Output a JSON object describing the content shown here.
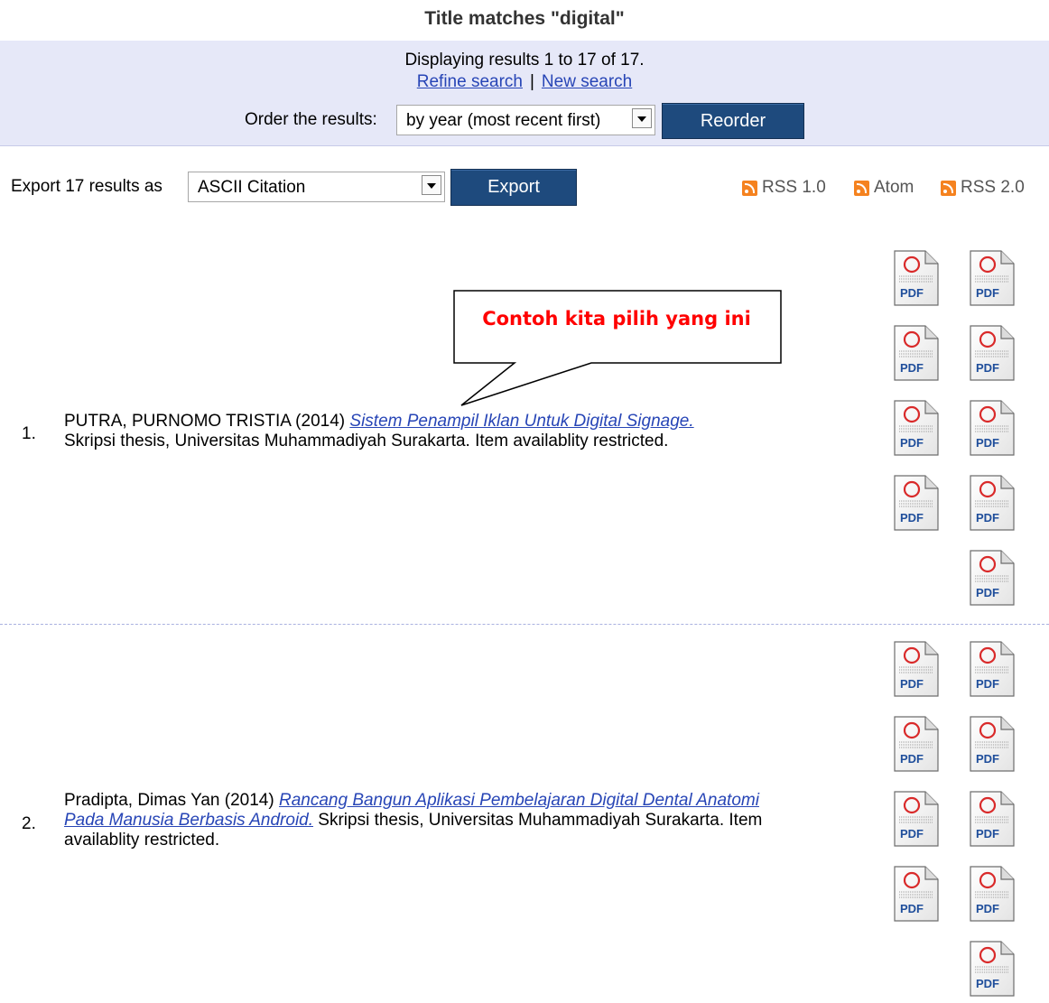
{
  "page": {
    "title": "Title matches \"digital\""
  },
  "summary": {
    "displaying": "Displaying results 1 to 17 of 17.",
    "refine_link": "Refine search",
    "separator": "|",
    "new_link": "New search",
    "order_label": "Order the results:",
    "order_selected": "by year (most recent first)",
    "reorder_button": "Reorder"
  },
  "export": {
    "label": "Export 17 results as",
    "format_selected": "ASCII Citation",
    "button": "Export"
  },
  "feeds": [
    {
      "icon": "rss-icon",
      "label": "RSS 1.0"
    },
    {
      "icon": "rss-icon",
      "label": "Atom"
    },
    {
      "icon": "rss-icon",
      "label": "RSS 2.0"
    }
  ],
  "callout": {
    "text": "Contoh kita pilih yang ini"
  },
  "results": [
    {
      "number": "1.",
      "authors": "PUTRA, PURNOMO TRISTIA (2014)",
      "title": "Sistem Penampil Iklan Untuk Digital Signage.",
      "rest": "Skripsi thesis, Universitas Muhammadiyah Surakarta. Item availablity restricted.",
      "pdf_count": 9
    },
    {
      "number": "2.",
      "authors": "Pradipta, Dimas Yan (2014)",
      "title": "Rancang Bangun Aplikasi Pembelajaran Digital Dental Anatomi Pada Manusia Berbasis Android.",
      "rest": "Skripsi thesis, Universitas Muhammadiyah Surakarta. Item availablity restricted.",
      "pdf_count": 9
    }
  ],
  "pdf_icon": {
    "label": "PDF",
    "icon": "pdf-file-icon"
  }
}
